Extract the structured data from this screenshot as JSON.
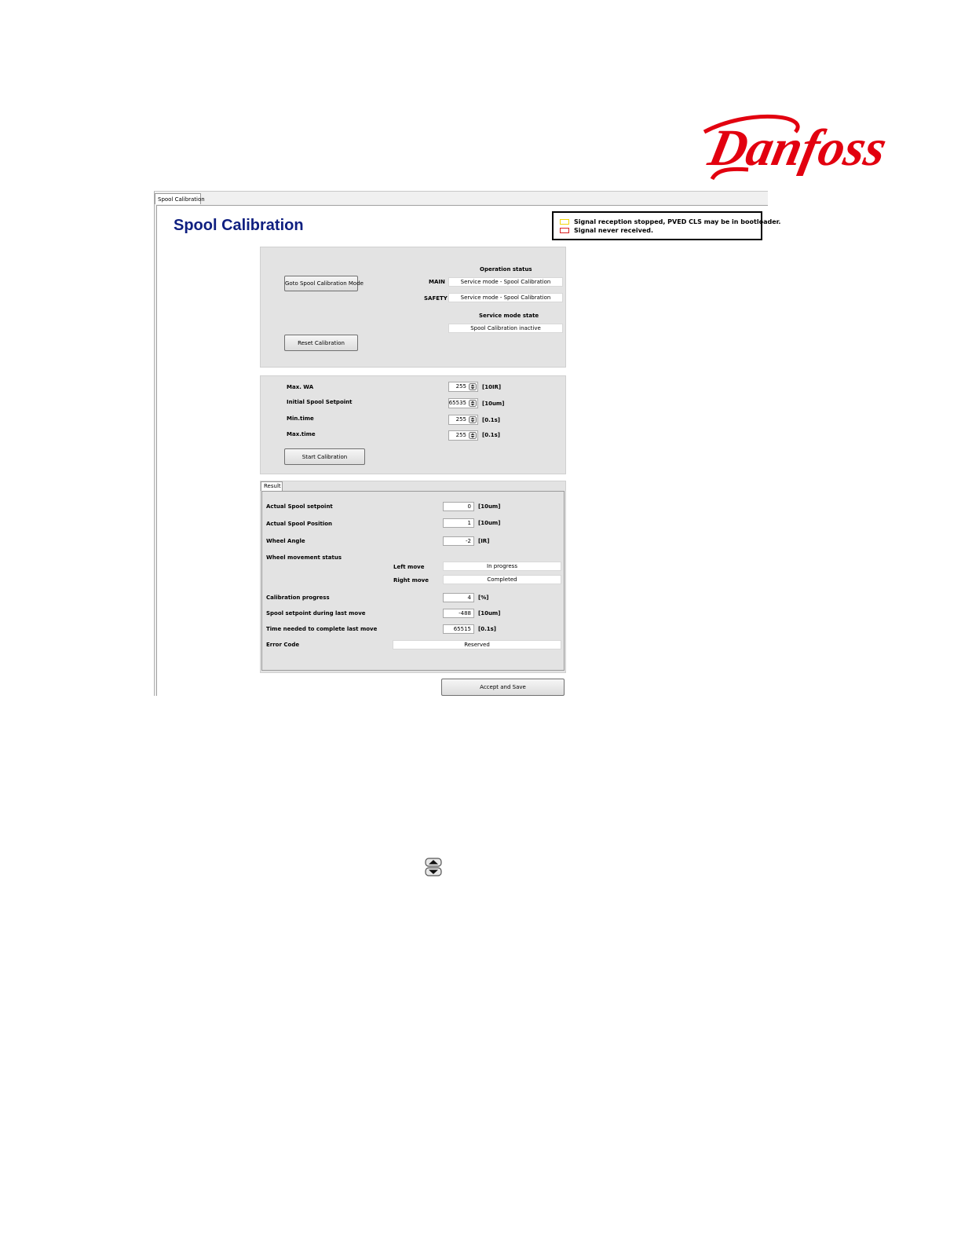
{
  "brand": {
    "logo_text": "Danfoss",
    "logo_color": "#e2000f"
  },
  "window": {
    "tab_label": "Spool Calibration",
    "page_title": "Spool Calibration"
  },
  "legend": {
    "yellow_text": "Signal reception stopped, PVED CLS may be in bootloader.",
    "red_text": "Signal never received.",
    "yellow_color": "#f3d60a",
    "red_color": "#d92020"
  },
  "mode_panel": {
    "goto_button": "Goto Spool Calibration Mode",
    "reset_button": "Reset Calibration",
    "operation_status_heading": "Operation status",
    "main_label": "MAIN",
    "main_value": "Service mode - Spool Calibration",
    "safety_label": "SAFETY",
    "safety_value": "Service mode - Spool Calibration",
    "service_mode_heading": "Service mode state",
    "service_mode_value": "Spool Calibration inactive"
  },
  "params_panel": {
    "rows": [
      {
        "label": "Max. WA",
        "value": "255",
        "unit": "[10IR]"
      },
      {
        "label": "Initial Spool Setpoint",
        "value": "65535",
        "unit": "[10um]"
      },
      {
        "label": "Min.time",
        "value": "255",
        "unit": "[0.1s]"
      },
      {
        "label": "Max.time",
        "value": "255",
        "unit": "[0.1s]"
      }
    ],
    "start_button": "Start Calibration"
  },
  "result_panel": {
    "tab_label": "Result",
    "actual_setpoint_label": "Actual Spool setpoint",
    "actual_setpoint_value": "0",
    "actual_setpoint_unit": "[10um]",
    "actual_position_label": "Actual Spool Position",
    "actual_position_value": "1",
    "actual_position_unit": "[10um]",
    "wheel_angle_label": "Wheel Angle",
    "wheel_angle_value": "-2",
    "wheel_angle_unit": "[IR]",
    "wheel_movement_label": "Wheel movement status",
    "left_move_label": "Left move",
    "left_move_value": "In progress",
    "right_move_label": "Right move",
    "right_move_value": "Completed",
    "progress_label": "Calibration progress",
    "progress_value": "4",
    "progress_unit": "[%]",
    "last_setpoint_label": "Spool setpoint during last move",
    "last_setpoint_value": "-488",
    "last_setpoint_unit": "[10um]",
    "time_needed_label": "Time needed to complete last move",
    "time_needed_value": "65515",
    "time_needed_unit": "[0.1s]",
    "error_code_label": "Error Code",
    "error_code_value": "Reserved"
  },
  "accept_button": "Accept and Save"
}
